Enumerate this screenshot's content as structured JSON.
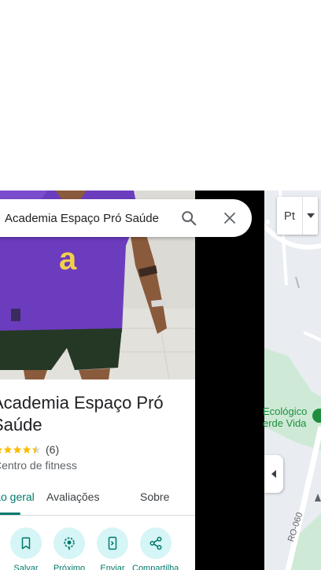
{
  "search": {
    "value": "Academia Espaço Pró Saúde"
  },
  "place": {
    "title": "Academia Espaço Pró Saúde",
    "rating_count": "(6)",
    "rating": 4.5,
    "category": "Centro de fitness"
  },
  "tabs": [
    {
      "label": "Visão geral",
      "active": true
    },
    {
      "label": "Avaliações",
      "active": false
    },
    {
      "label": "Sobre",
      "active": false
    }
  ],
  "actions": [
    {
      "label": "Salvar",
      "icon": "bookmark-icon"
    },
    {
      "label": "Próximo",
      "icon": "nearby-icon"
    },
    {
      "label": "Enviar",
      "icon": "send-to-phone-icon"
    },
    {
      "label": "Compartilhar",
      "icon": "share-icon"
    }
  ],
  "map": {
    "layer_label": "Pt",
    "place_label_line1": "Ecológico",
    "place_label_line2": "erde Vida",
    "road_label": "RO-060"
  },
  "colors": {
    "accent": "#00796b",
    "action_bg": "#d5f5f6",
    "star": "#fbbc04",
    "map_green": "#1e8e3e"
  }
}
